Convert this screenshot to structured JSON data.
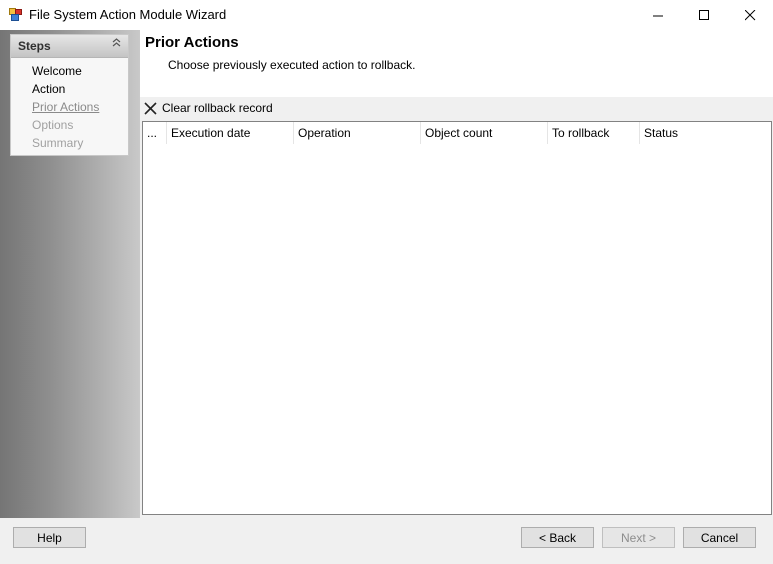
{
  "window": {
    "title": "File System Action Module Wizard",
    "minimize_glyph": "—",
    "maximize_glyph": "☐",
    "close_glyph": "✕"
  },
  "sidebar": {
    "steps_title": "Steps",
    "collapse_glyph": "︽",
    "items": [
      {
        "label": "Welcome",
        "state": "done"
      },
      {
        "label": "Action",
        "state": "done"
      },
      {
        "label": "Prior Actions",
        "state": "current"
      },
      {
        "label": "Options",
        "state": "pending"
      },
      {
        "label": "Summary",
        "state": "pending"
      }
    ]
  },
  "page": {
    "title": "Prior Actions",
    "subtitle": "Choose previously executed action to rollback."
  },
  "toolbar": {
    "clear_label": "Clear rollback record"
  },
  "grid": {
    "columns": [
      "...",
      "Execution date",
      "Operation",
      "Object count",
      "To rollback",
      "Status"
    ],
    "rows": []
  },
  "footer": {
    "help_label": "Help",
    "back_label": "< Back",
    "next_label": "Next >",
    "cancel_label": "Cancel"
  },
  "colors": {
    "step_done": "#000000",
    "step_current": "#8a8a8a",
    "step_pending": "#a0a0a0"
  }
}
